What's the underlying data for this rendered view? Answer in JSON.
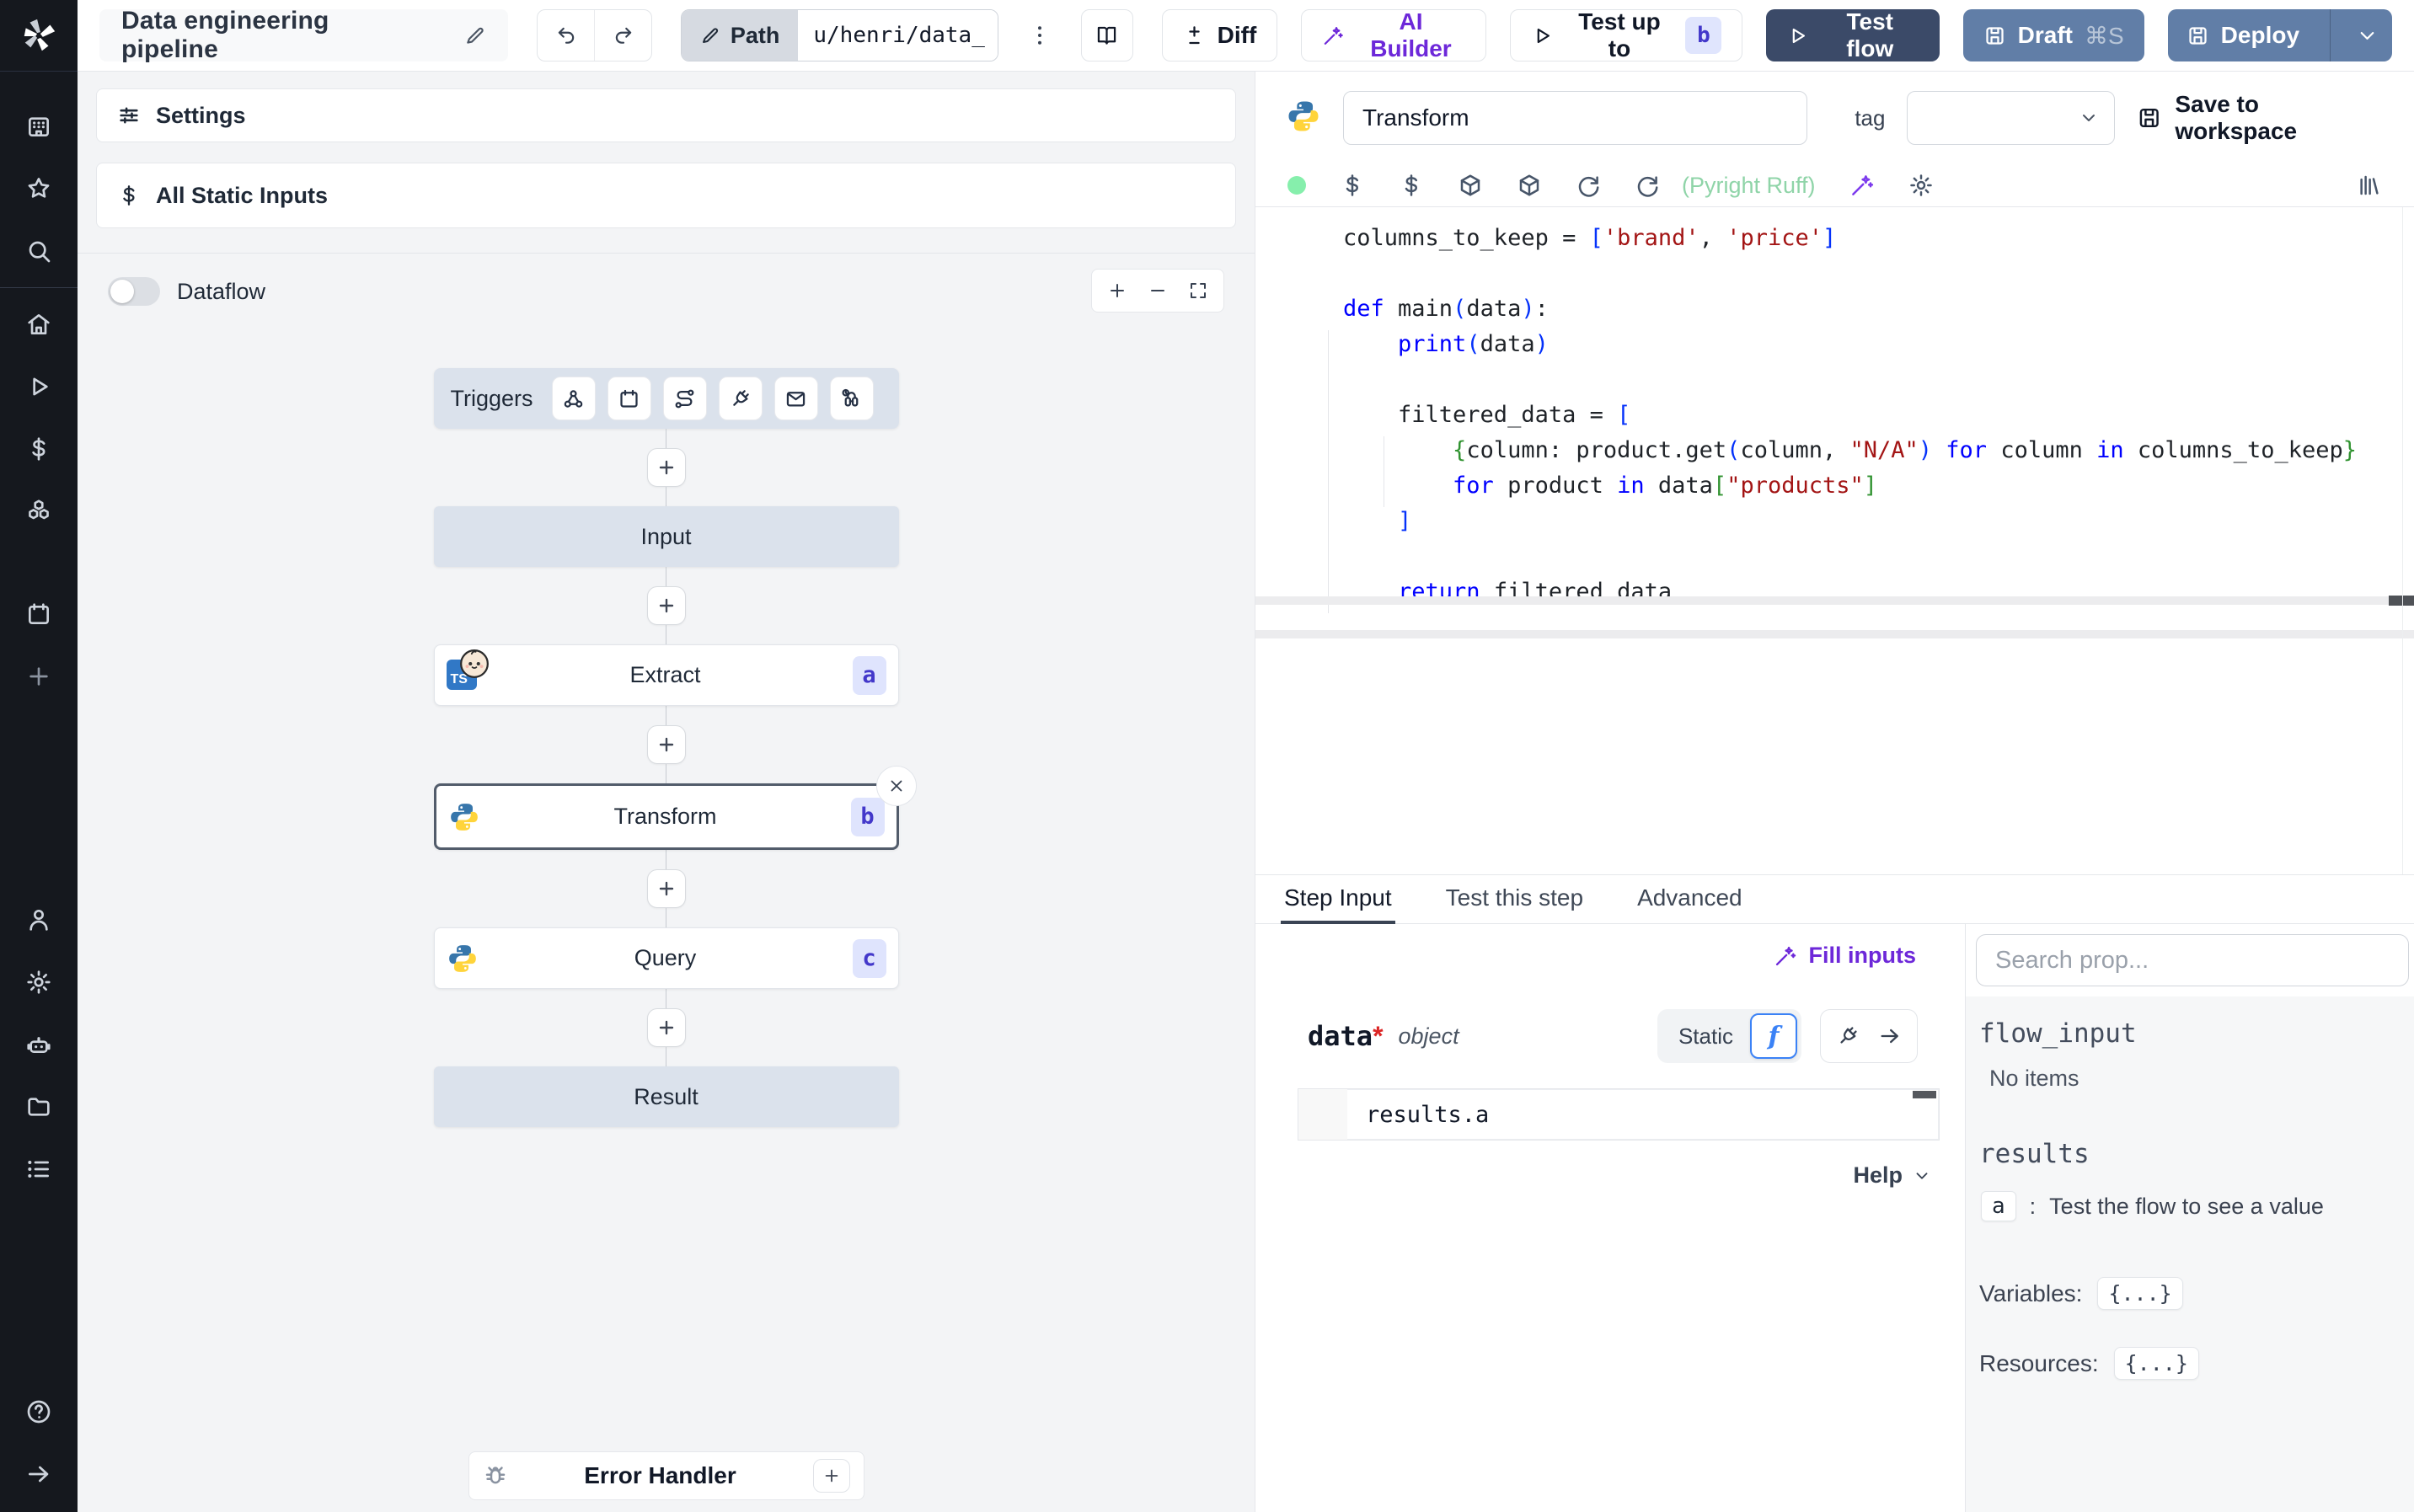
{
  "topbar": {
    "title": "Data engineering pipeline",
    "path_label": "Path",
    "path_value": "u/henri/data_",
    "diff_label": "Diff",
    "ai_builder_label": "AI Builder",
    "test_up_to_label": "Test up to",
    "test_up_to_badge": "b",
    "test_flow_label": "Test flow",
    "draft_label": "Draft",
    "draft_shortcut": "⌘S",
    "deploy_label": "Deploy"
  },
  "flow": {
    "settings_label": "Settings",
    "all_static_inputs_label": "All Static Inputs",
    "dataflow_label": "Dataflow",
    "triggers_label": "Triggers",
    "input_label": "Input",
    "result_label": "Result",
    "error_handler_label": "Error Handler",
    "steps": [
      {
        "label": "Extract",
        "badge": "a",
        "lang": "typescript-bun"
      },
      {
        "label": "Transform",
        "badge": "b",
        "lang": "python"
      },
      {
        "label": "Query",
        "badge": "c",
        "lang": "python"
      }
    ]
  },
  "editor": {
    "step_name": "Transform",
    "tag_label": "tag",
    "save_label": "Save to workspace",
    "lint_label": "(Pyright Ruff)",
    "code": [
      "columns_to_keep = ['brand', 'price']",
      "",
      "def main(data):",
      "    print(data)",
      "",
      "    filtered_data = [",
      "        {column: product.get(column, \"N/A\") for column in columns_to_keep}",
      "        for product in data[\"products\"]",
      "    ]",
      "",
      "    return filtered_data"
    ]
  },
  "step_panel": {
    "tabs": [
      "Step Input",
      "Test this step",
      "Advanced"
    ],
    "fill_inputs_label": "Fill inputs",
    "arg_name": "data",
    "arg_required_mark": "*",
    "arg_type": "object",
    "static_label": "Static",
    "fn_toggle_glyph": "f",
    "expr_value": "results.a",
    "help_label": "Help"
  },
  "props_panel": {
    "search_placeholder": "Search prop...",
    "flow_input_title": "flow_input",
    "flow_input_empty": "No items",
    "results_title": "results",
    "result_key": "a",
    "result_separator": ":",
    "result_hint": "Test the flow to see a value",
    "variables_label": "Variables:",
    "variables_value": "{...}",
    "resources_label": "Resources:",
    "resources_value": "{...}"
  },
  "icons": {
    "rail": [
      "workspace-icon",
      "favorites-star-icon",
      "search-icon",
      "home-icon",
      "runs-play-icon",
      "variables-dollar-icon",
      "resources-cubes-icon",
      "schedules-calendar-icon",
      "add-plus-icon",
      "user-icon",
      "settings-gear-icon",
      "workers-robot-icon",
      "folders-icon",
      "audit-logs-icon",
      "help-icon",
      "expand-arrow-icon"
    ],
    "triggers": [
      "webhook-icon",
      "schedule-calendar-icon",
      "http-route-icon",
      "websocket-plug-icon",
      "email-icon",
      "poll-watch-icon"
    ],
    "editor_toolbar": [
      "status-dot",
      "context-var-icon",
      "context-var-icon",
      "package-icon",
      "package-icon",
      "reload-icon",
      "reload-icon",
      "assistant-wand-icon",
      "editor-settings-gear-icon",
      "library-icon"
    ]
  },
  "colors": {
    "accent_dark_button": "#3b4a68",
    "slate_button": "#617ea7",
    "violet": "#6d28d9",
    "badge_bg": "#dfe4fd",
    "badge_text": "#4338ca",
    "lint_green": "#8fd4a8",
    "keyword_blue": "#0000ff",
    "string_red": "#a31515"
  }
}
